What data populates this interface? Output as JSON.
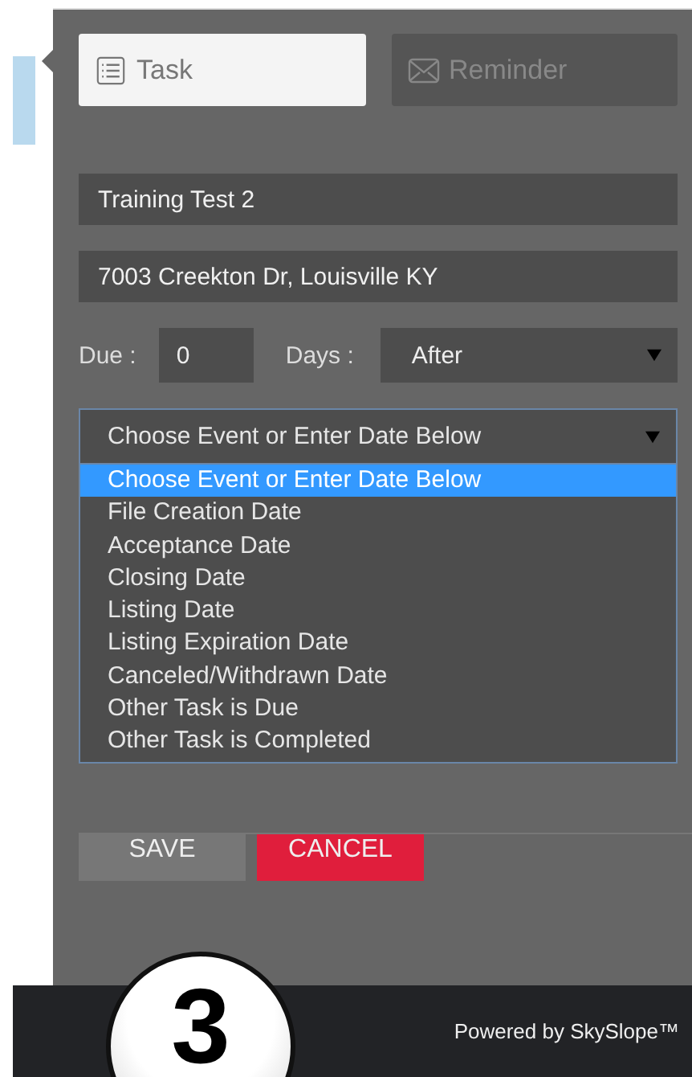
{
  "tabs": [
    {
      "label": "Task",
      "kind": "task",
      "selected": true
    },
    {
      "label": "Reminder",
      "kind": "reminder",
      "selected": false
    }
  ],
  "fields": [
    {
      "value": "Training Test 2"
    },
    {
      "value": "7003 Creekton Dr, Louisville KY"
    }
  ],
  "due": {
    "label": "Due :",
    "value": "0",
    "days_label": "Days :",
    "relation": "After"
  },
  "event_select": {
    "value": "Choose Event or Enter Date Below",
    "options": [
      {
        "label": "Choose Event or Enter Date Below",
        "selected": true
      },
      {
        "label": "File Creation Date",
        "selected": false
      },
      {
        "label": "Acceptance Date",
        "selected": false
      },
      {
        "label": "Closing Date",
        "selected": false
      },
      {
        "label": "Listing Date",
        "selected": false
      },
      {
        "label": "Listing Expiration Date",
        "selected": false
      },
      {
        "label": "Canceled/Withdrawn Date",
        "selected": false
      },
      {
        "label": "Other Task is Due",
        "selected": false
      },
      {
        "label": "Other Task is Completed",
        "selected": false
      }
    ]
  },
  "buttons": [
    {
      "label": "SAVE",
      "kind": "save"
    },
    {
      "label": "CANCEL",
      "kind": "cancel"
    }
  ],
  "footer": {
    "text": "Powered by SkySlope™"
  },
  "callout": {
    "number": "3"
  }
}
